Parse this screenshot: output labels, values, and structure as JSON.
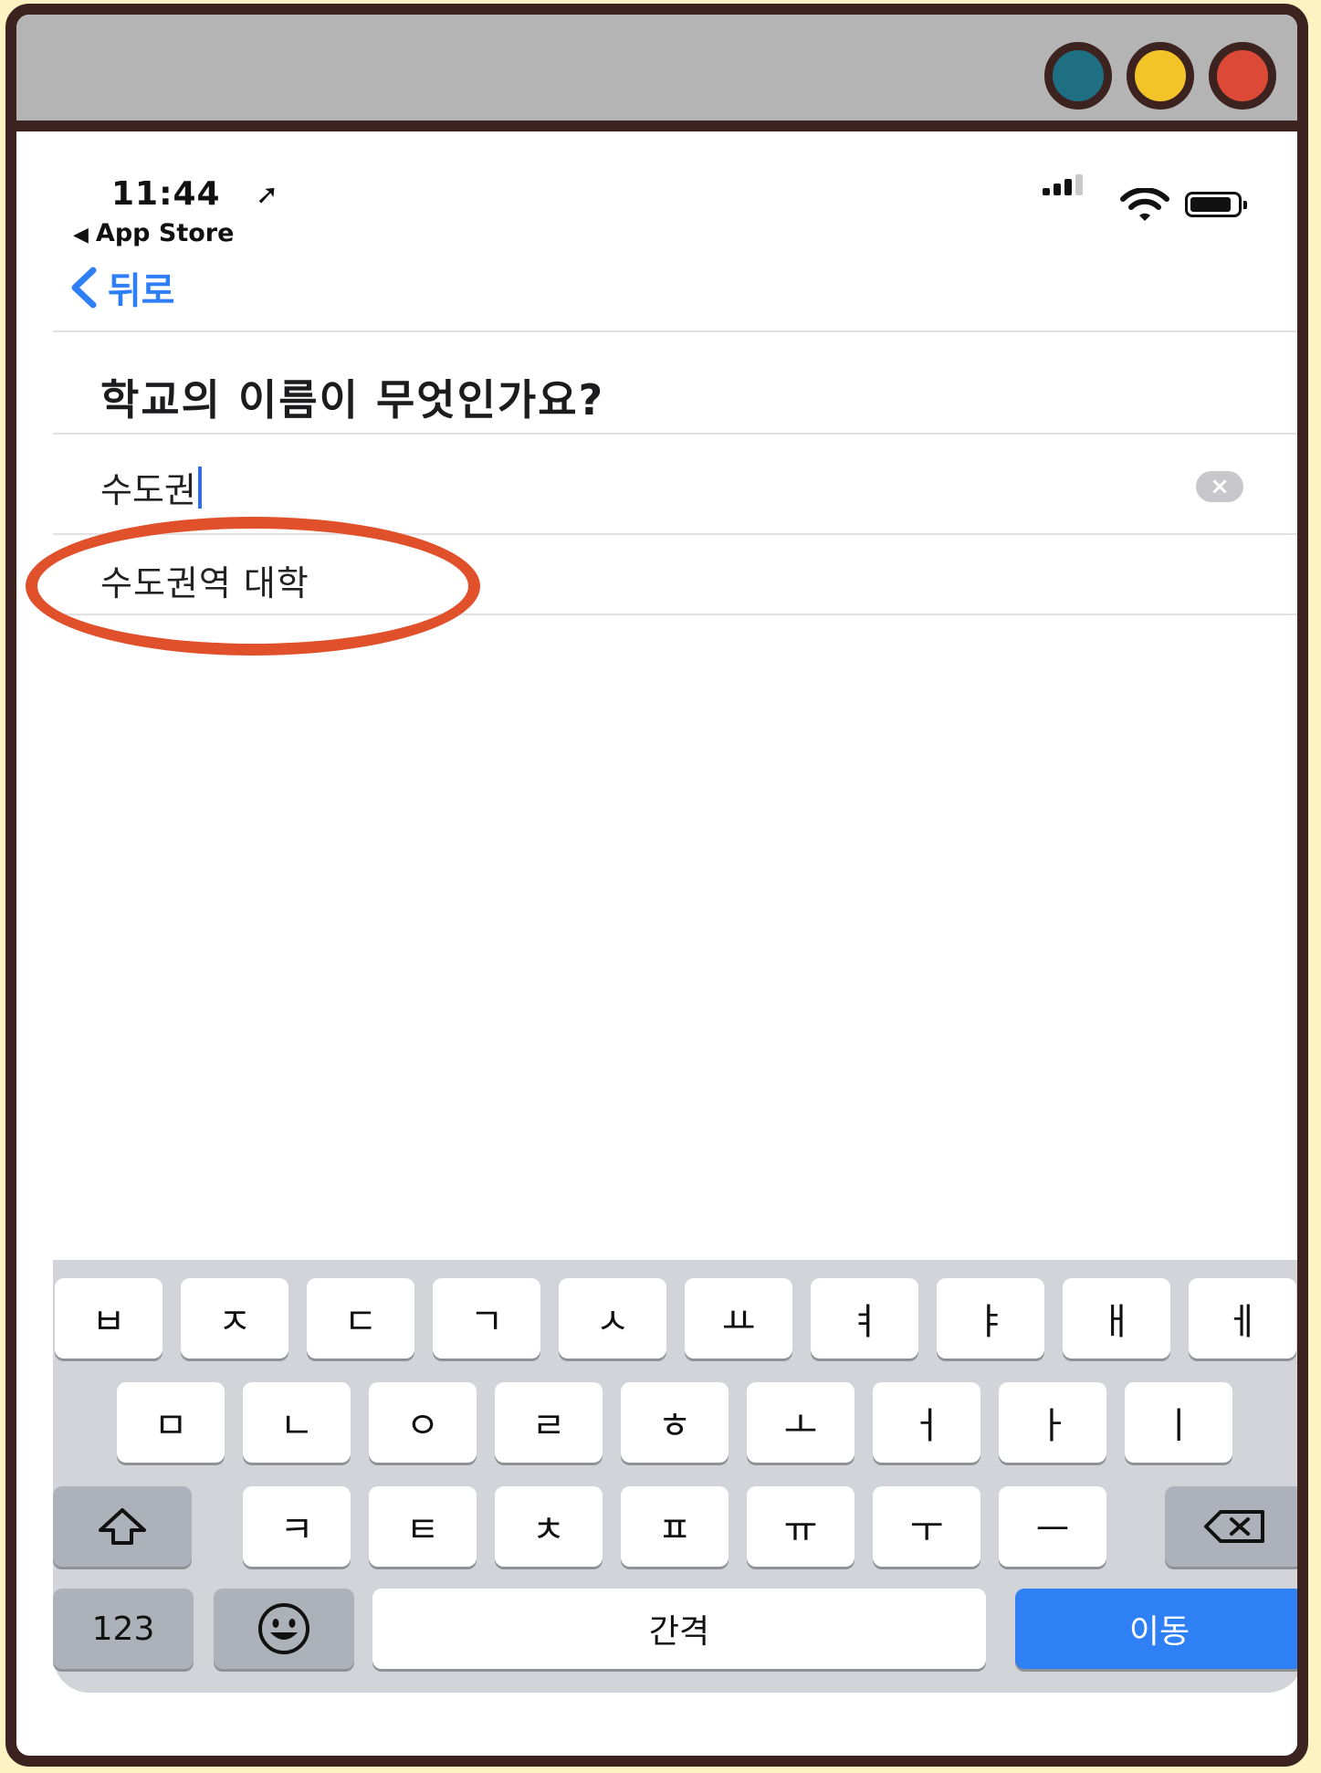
{
  "window": {
    "controls": [
      {
        "name": "teal-dot",
        "color": "#1f6f82"
      },
      {
        "name": "yellow-dot",
        "color": "#f3c428"
      },
      {
        "name": "red-dot",
        "color": "#dc4a37"
      }
    ],
    "frame_color": "#3d2320"
  },
  "statusbar": {
    "time": "11:44",
    "back_app": "App Store"
  },
  "nav": {
    "back_label": "뒤로",
    "accent": "#2d7ef7"
  },
  "form": {
    "question": "학교의 이름이 무엇인가요?",
    "input_value": "수도권",
    "suggestion": "수도권역 대학"
  },
  "highlight_color": "#e0502b",
  "keyboard": {
    "row1": [
      "ㅂ",
      "ㅈ",
      "ㄷ",
      "ㄱ",
      "ㅅ",
      "ㅛ",
      "ㅕ",
      "ㅑ",
      "ㅐ",
      "ㅔ"
    ],
    "row2": [
      "ㅁ",
      "ㄴ",
      "ㅇ",
      "ㄹ",
      "ㅎ",
      "ㅗ",
      "ㅓ",
      "ㅏ",
      "ㅣ"
    ],
    "row3": [
      "ㅋ",
      "ㅌ",
      "ㅊ",
      "ㅍ",
      "ㅠ",
      "ㅜ",
      "ㅡ"
    ],
    "numbers_label": "123",
    "space_label": "간격",
    "go_label": "이동"
  }
}
